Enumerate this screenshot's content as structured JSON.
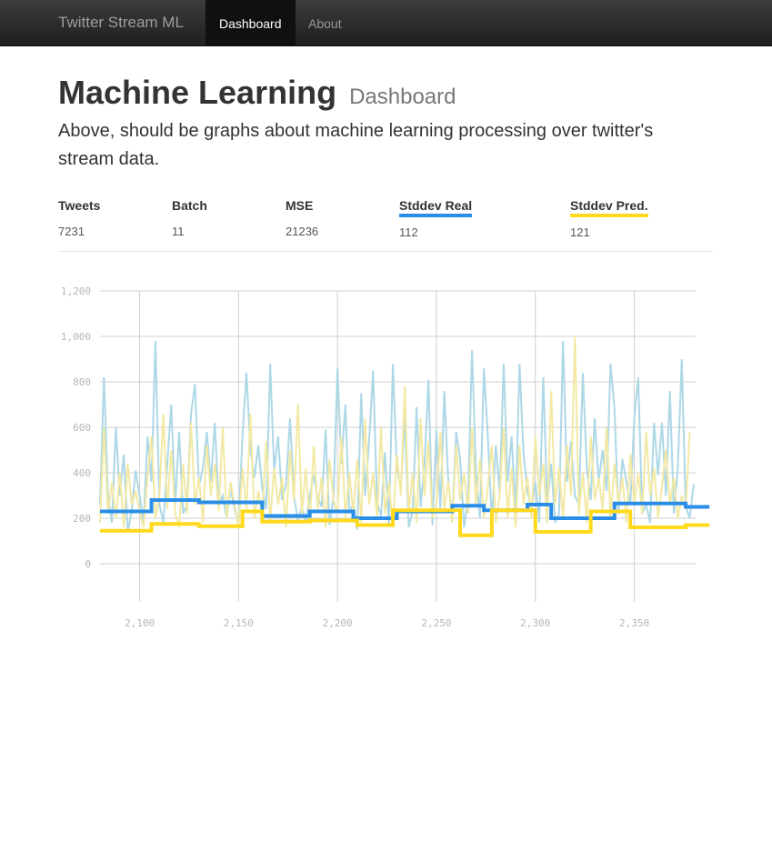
{
  "navbar": {
    "brand": "Twitter Stream ML",
    "items": [
      {
        "label": "Dashboard",
        "active": true
      },
      {
        "label": "About",
        "active": false
      }
    ]
  },
  "header": {
    "title": "Machine Learning",
    "subtitle": "Dashboard",
    "lead": "Above, should be graphs about machine learning processing over twitter's stream data."
  },
  "stats": [
    {
      "label": "Tweets",
      "value": "7231"
    },
    {
      "label": "Batch",
      "value": "11"
    },
    {
      "label": "MSE",
      "value": "21236"
    },
    {
      "label": "Stddev Real",
      "value": "112",
      "color": "#2a8ee8"
    },
    {
      "label": "Stddev Pred.",
      "value": "121",
      "color": "#ffd91c"
    }
  ],
  "chart_data": {
    "type": "line",
    "xlim": [
      2080,
      2381
    ],
    "ylim": [
      -200,
      1200
    ],
    "x_ticks": [
      2100,
      2150,
      2200,
      2250,
      2300,
      2350
    ],
    "x_tick_labels": [
      "2,100",
      "2,150",
      "2,200",
      "2,250",
      "2,300",
      "2,350"
    ],
    "y_ticks": [
      0,
      200,
      400,
      600,
      800,
      1000,
      1200
    ],
    "y_tick_labels": [
      "0",
      "200",
      "400",
      "600",
      "800",
      "1,000",
      "1,200"
    ],
    "grid": true,
    "series": [
      {
        "color": "#add8e6",
        "x_start": 2080,
        "x_step": 2,
        "values": [
          260,
          820,
          300,
          180,
          600,
          300,
          480,
          140,
          230,
          410,
          300,
          180,
          560,
          360,
          980,
          260,
          180,
          440,
          700,
          260,
          580,
          220,
          260,
          660,
          790,
          340,
          420,
          580,
          360,
          620,
          260,
          300,
          200,
          330,
          240,
          180,
          560,
          840,
          500,
          380,
          520,
          330,
          240,
          880,
          410,
          560,
          280,
          350,
          640,
          300,
          190,
          250,
          180,
          300,
          390,
          290,
          250,
          590,
          170,
          290,
          860,
          440,
          700,
          220,
          270,
          150,
          750,
          300,
          540,
          850,
          270,
          210,
          490,
          170,
          880,
          420,
          330,
          640,
          160,
          230,
          690,
          250,
          440,
          810,
          170,
          590,
          240,
          760,
          360,
          200,
          580,
          460,
          160,
          290,
          940,
          400,
          200,
          860,
          560,
          180,
          520,
          310,
          880,
          360,
          560,
          220,
          880,
          490,
          320,
          240,
          360,
          180,
          820,
          260,
          440,
          180,
          220,
          980,
          360,
          540,
          300,
          260,
          840,
          420,
          280,
          640,
          360,
          500,
          320,
          880,
          680,
          220,
          460,
          360,
          260,
          640,
          820,
          220,
          260,
          180,
          620,
          390,
          620,
          300,
          760,
          220,
          420,
          900,
          250,
          200,
          350
        ]
      },
      {
        "color": "#f3e9a4",
        "x_start": 2080,
        "x_step": 2,
        "values": [
          180,
          600,
          220,
          360,
          200,
          400,
          160,
          440,
          260,
          320,
          230,
          160,
          380,
          560,
          200,
          300,
          660,
          240,
          500,
          220,
          160,
          440,
          220,
          620,
          260,
          380,
          180,
          520,
          300,
          440,
          230,
          600,
          200,
          360,
          260,
          160,
          420,
          240,
          660,
          200,
          320,
          220,
          540,
          180,
          420,
          260,
          380,
          160,
          500,
          280,
          700,
          220,
          420,
          180,
          520,
          240,
          380,
          160,
          460,
          280,
          220,
          560,
          200,
          400,
          220,
          460,
          180,
          640,
          260,
          400,
          200,
          600,
          220,
          360,
          160,
          480,
          300,
          780,
          220,
          400,
          180,
          640,
          300,
          540,
          200,
          260,
          580,
          240,
          360,
          180,
          520,
          280,
          400,
          220,
          600,
          260,
          460,
          200,
          340,
          520,
          180,
          300,
          600,
          200,
          420,
          160,
          520,
          260,
          380,
          200,
          560,
          300,
          440,
          180,
          760,
          260,
          420,
          200,
          520,
          300,
          1000,
          220,
          400,
          180,
          560,
          280,
          380,
          240,
          600,
          200,
          440,
          260,
          380,
          180,
          480,
          260,
          400,
          220,
          580,
          300,
          420,
          200,
          340,
          500,
          260,
          380,
          200,
          300,
          240,
          580
        ]
      },
      {
        "color": "#2a8ee8",
        "x_start": 2080,
        "x_step": 2,
        "values": [
          230,
          230,
          230,
          230,
          230,
          230,
          230,
          230,
          230,
          230,
          230,
          230,
          230,
          280,
          280,
          280,
          280,
          280,
          280,
          280,
          280,
          280,
          280,
          280,
          280,
          270,
          270,
          270,
          270,
          270,
          270,
          270,
          270,
          270,
          270,
          270,
          270,
          270,
          270,
          270,
          270,
          210,
          210,
          210,
          210,
          210,
          210,
          210,
          210,
          210,
          210,
          210,
          210,
          230,
          230,
          230,
          230,
          230,
          230,
          230,
          230,
          230,
          230,
          230,
          200,
          200,
          200,
          200,
          200,
          200,
          200,
          200,
          200,
          200,
          200,
          230,
          230,
          230,
          230,
          230,
          230,
          230,
          230,
          230,
          230,
          230,
          230,
          230,
          230,
          255,
          255,
          255,
          255,
          255,
          255,
          255,
          255,
          235,
          235,
          235,
          235,
          235,
          235,
          235,
          235,
          235,
          235,
          235,
          260,
          260,
          260,
          260,
          260,
          260,
          200,
          200,
          200,
          200,
          200,
          200,
          200,
          200,
          200,
          200,
          200,
          200,
          200,
          200,
          200,
          200,
          265,
          265,
          265,
          265,
          265,
          265,
          265,
          265,
          265,
          265,
          265,
          265,
          265,
          265,
          265,
          265,
          265,
          265,
          250,
          250,
          250,
          250,
          250,
          250,
          250
        ]
      },
      {
        "color": "#ffd91c",
        "x_start": 2080,
        "x_step": 2,
        "values": [
          145,
          145,
          145,
          145,
          145,
          145,
          145,
          145,
          145,
          145,
          145,
          145,
          145,
          175,
          175,
          175,
          175,
          175,
          175,
          175,
          175,
          175,
          175,
          175,
          175,
          165,
          165,
          165,
          165,
          165,
          165,
          165,
          165,
          165,
          165,
          165,
          230,
          230,
          230,
          230,
          230,
          185,
          185,
          185,
          185,
          185,
          185,
          185,
          185,
          185,
          185,
          185,
          185,
          190,
          190,
          190,
          190,
          190,
          190,
          190,
          190,
          190,
          190,
          190,
          190,
          170,
          170,
          170,
          170,
          170,
          170,
          170,
          170,
          170,
          235,
          235,
          235,
          235,
          235,
          235,
          235,
          235,
          235,
          235,
          235,
          235,
          235,
          235,
          235,
          235,
          235,
          125,
          125,
          125,
          125,
          125,
          125,
          125,
          125,
          235,
          235,
          235,
          235,
          235,
          235,
          235,
          235,
          235,
          235,
          235,
          140,
          140,
          140,
          140,
          140,
          140,
          140,
          140,
          140,
          140,
          140,
          140,
          140,
          140,
          230,
          230,
          230,
          230,
          230,
          230,
          230,
          230,
          230,
          230,
          160,
          160,
          160,
          160,
          160,
          160,
          160,
          160,
          160,
          160,
          160,
          160,
          160,
          160,
          170,
          170,
          170,
          170,
          170,
          170,
          170
        ]
      }
    ]
  }
}
